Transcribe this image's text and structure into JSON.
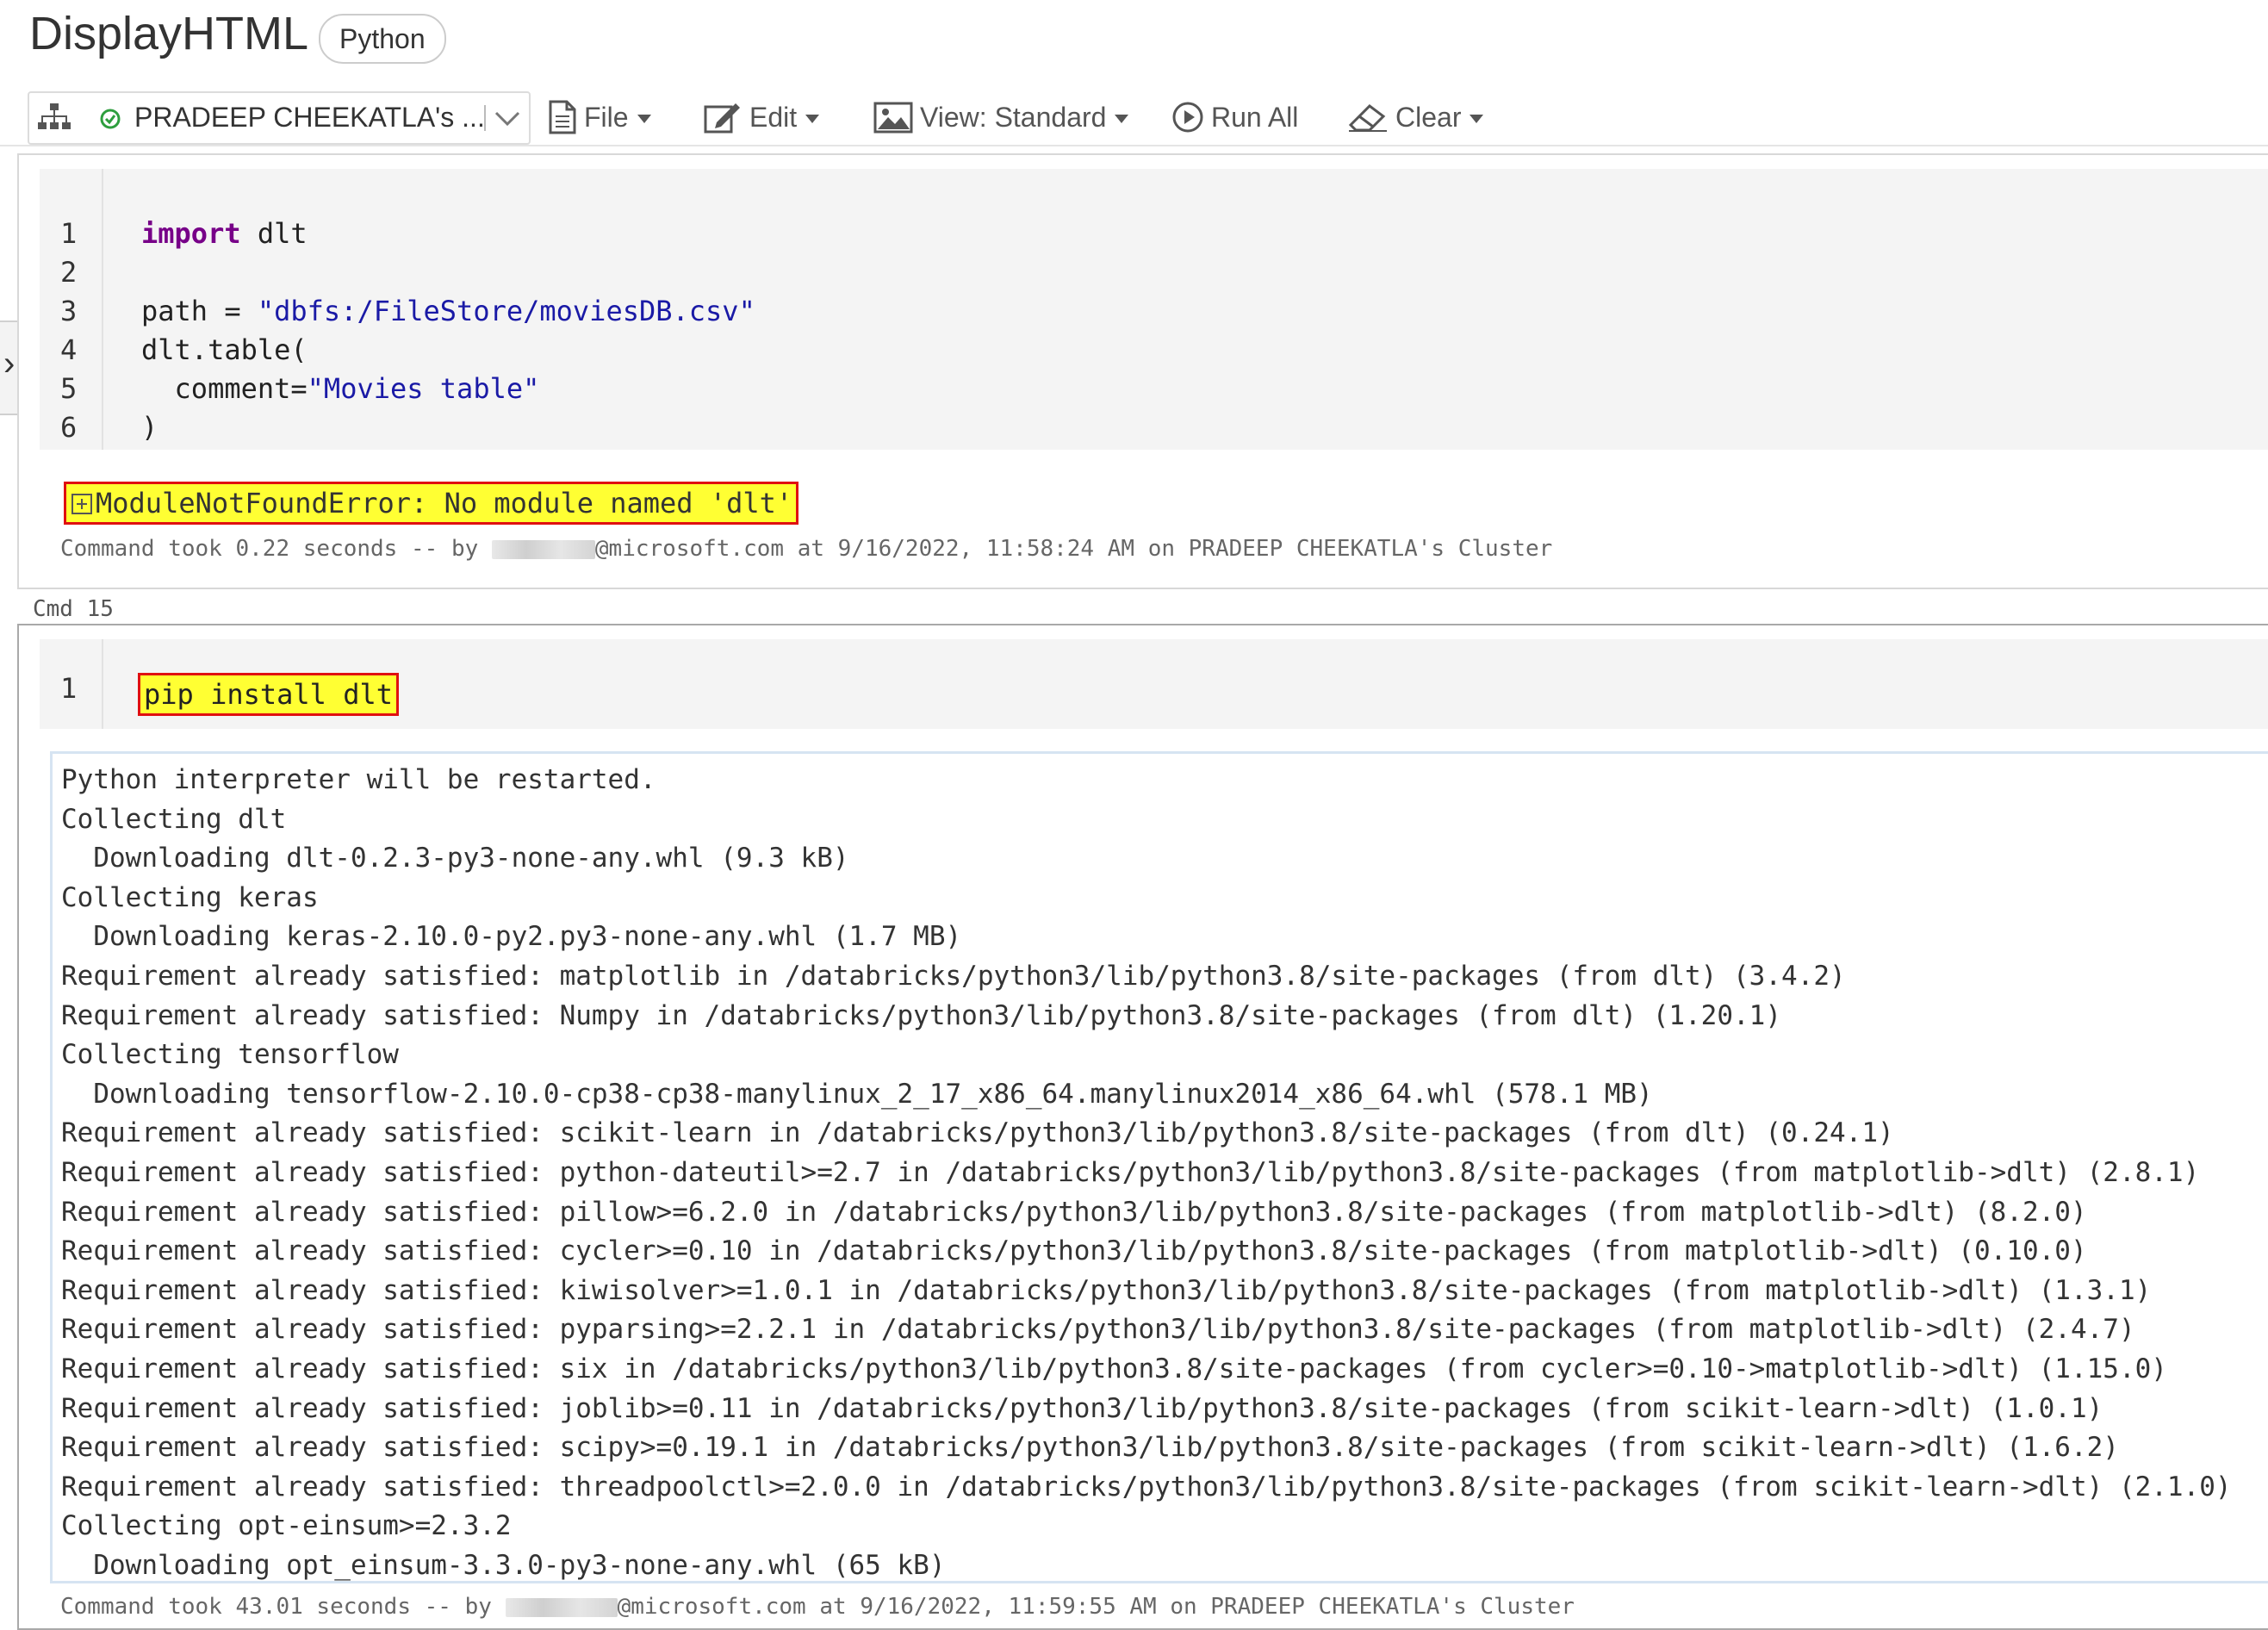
{
  "header": {
    "title": "DisplayHTML",
    "language": "Python"
  },
  "toolbar": {
    "cluster_name": "PRADEEP CHEEKATLA's ...",
    "file_label": "File",
    "edit_label": "Edit",
    "view_label": "View: Standard",
    "run_all_label": "Run All",
    "clear_label": "Clear"
  },
  "cell1": {
    "line_numbers": [
      "1",
      "2",
      "3",
      "4",
      "5",
      "6"
    ],
    "code": {
      "l1_kw": "import",
      "l1_rest": " dlt",
      "l3_pre": "path = ",
      "l3_str": "\"dbfs:/FileStore/moviesDB.csv\"",
      "l4": "dlt.table(",
      "l5_pre": "  comment=",
      "l5_str": "\"Movies table\"",
      "l6": ")"
    },
    "error": "ModuleNotFoundError: No module named 'dlt'",
    "footer_prefix": "Command took 0.22 seconds -- by ",
    "footer_suffix": "@microsoft.com at 9/16/2022, 11:58:24 AM on PRADEEP CHEEKATLA's Cluster"
  },
  "cmd_label": "Cmd 15",
  "cell2": {
    "line_numbers": [
      "1"
    ],
    "code": "pip install dlt",
    "output": [
      "Python interpreter will be restarted.",
      "Collecting dlt",
      "  Downloading dlt-0.2.3-py3-none-any.whl (9.3 kB)",
      "Collecting keras",
      "  Downloading keras-2.10.0-py2.py3-none-any.whl (1.7 MB)",
      "Requirement already satisfied: matplotlib in /databricks/python3/lib/python3.8/site-packages (from dlt) (3.4.2)",
      "Requirement already satisfied: Numpy in /databricks/python3/lib/python3.8/site-packages (from dlt) (1.20.1)",
      "Collecting tensorflow",
      "  Downloading tensorflow-2.10.0-cp38-cp38-manylinux_2_17_x86_64.manylinux2014_x86_64.whl (578.1 MB)",
      "Requirement already satisfied: scikit-learn in /databricks/python3/lib/python3.8/site-packages (from dlt) (0.24.1)",
      "Requirement already satisfied: python-dateutil>=2.7 in /databricks/python3/lib/python3.8/site-packages (from matplotlib->dlt) (2.8.1)",
      "Requirement already satisfied: pillow>=6.2.0 in /databricks/python3/lib/python3.8/site-packages (from matplotlib->dlt) (8.2.0)",
      "Requirement already satisfied: cycler>=0.10 in /databricks/python3/lib/python3.8/site-packages (from matplotlib->dlt) (0.10.0)",
      "Requirement already satisfied: kiwisolver>=1.0.1 in /databricks/python3/lib/python3.8/site-packages (from matplotlib->dlt) (1.3.1)",
      "Requirement already satisfied: pyparsing>=2.2.1 in /databricks/python3/lib/python3.8/site-packages (from matplotlib->dlt) (2.4.7)",
      "Requirement already satisfied: six in /databricks/python3/lib/python3.8/site-packages (from cycler>=0.10->matplotlib->dlt) (1.15.0)",
      "Requirement already satisfied: joblib>=0.11 in /databricks/python3/lib/python3.8/site-packages (from scikit-learn->dlt) (1.0.1)",
      "Requirement already satisfied: scipy>=0.19.1 in /databricks/python3/lib/python3.8/site-packages (from scikit-learn->dlt) (1.6.2)",
      "Requirement already satisfied: threadpoolctl>=2.0.0 in /databricks/python3/lib/python3.8/site-packages (from scikit-learn->dlt) (2.1.0)",
      "Collecting opt-einsum>=2.3.2",
      "  Downloading opt_einsum-3.3.0-py3-none-any.whl (65 kB)"
    ],
    "footer_prefix": "Command took 43.01 seconds -- by ",
    "footer_suffix": "@microsoft.com at 9/16/2022, 11:59:55 AM on PRADEEP CHEEKATLA's Cluster"
  },
  "colors": {
    "highlight": "#ffff33",
    "highlight_border": "#e01010",
    "keyword": "#770088",
    "string": "#1a1aa6",
    "status_ok": "#2e9e3e"
  },
  "icons": [
    "cluster-tree-icon",
    "status-ok-icon",
    "chevron-down-icon",
    "file-icon",
    "edit-icon",
    "image-icon",
    "play-icon",
    "eraser-icon",
    "expand-panel-icon",
    "expand-plus-icon"
  ]
}
